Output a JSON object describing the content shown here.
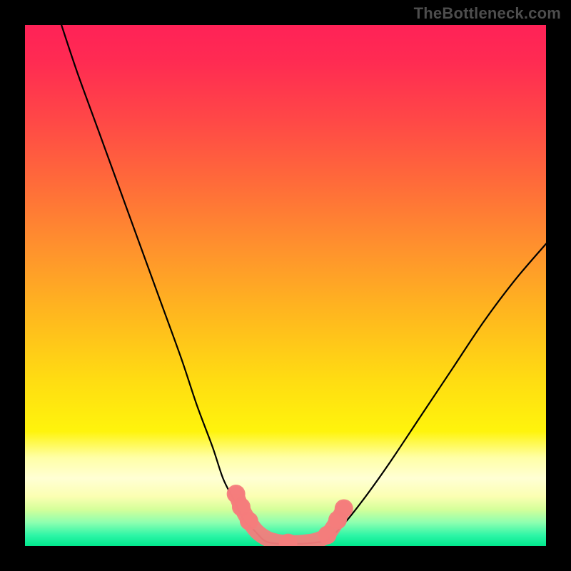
{
  "watermark": "TheBottleneck.com",
  "chart_data": {
    "type": "line",
    "title": "",
    "xlabel": "",
    "ylabel": "",
    "xlim": [
      0,
      100
    ],
    "ylim": [
      0,
      100
    ],
    "background_gradient": {
      "stops": [
        {
          "offset": 0.0,
          "color": "#ff2257"
        },
        {
          "offset": 0.07,
          "color": "#ff2b52"
        },
        {
          "offset": 0.18,
          "color": "#ff4747"
        },
        {
          "offset": 0.3,
          "color": "#ff6a3a"
        },
        {
          "offset": 0.42,
          "color": "#ff8f2e"
        },
        {
          "offset": 0.55,
          "color": "#ffb61f"
        },
        {
          "offset": 0.68,
          "color": "#ffdc12"
        },
        {
          "offset": 0.78,
          "color": "#fff40c"
        },
        {
          "offset": 0.83,
          "color": "#ffffa6"
        },
        {
          "offset": 0.87,
          "color": "#ffffd4"
        },
        {
          "offset": 0.905,
          "color": "#fbffb2"
        },
        {
          "offset": 0.93,
          "color": "#d4ff9a"
        },
        {
          "offset": 0.955,
          "color": "#8dffb0"
        },
        {
          "offset": 0.98,
          "color": "#2cf5a6"
        },
        {
          "offset": 1.0,
          "color": "#00e88d"
        }
      ]
    },
    "series": [
      {
        "name": "left-curve",
        "x": [
          7,
          10,
          14,
          18,
          22,
          26,
          30,
          33,
          36,
          38,
          40,
          42,
          44,
          46
        ],
        "y": [
          100,
          91,
          80,
          69,
          58,
          47,
          36,
          27,
          19,
          13,
          9,
          5,
          3,
          1
        ],
        "stroke": "#000000",
        "width": 2.1
      },
      {
        "name": "floor",
        "x": [
          46,
          48,
          50,
          52,
          54,
          56,
          58
        ],
        "y": [
          1,
          0.5,
          0.4,
          0.4,
          0.5,
          0.7,
          1.2
        ],
        "stroke": "#000000",
        "width": 2.1
      },
      {
        "name": "right-curve",
        "x": [
          58,
          61,
          65,
          70,
          76,
          82,
          88,
          94,
          100
        ],
        "y": [
          1.2,
          4,
          9,
          16,
          25,
          34,
          43,
          51,
          58
        ],
        "stroke": "#000000",
        "width": 2.1
      },
      {
        "name": "marker-band",
        "type": "scatter",
        "points": [
          {
            "x": 40.5,
            "y": 10.0
          },
          {
            "x": 41.5,
            "y": 7.5
          },
          {
            "x": 43.0,
            "y": 4.8
          },
          {
            "x": 44.5,
            "y": 2.8
          },
          {
            "x": 46.5,
            "y": 1.4
          },
          {
            "x": 48.5,
            "y": 0.8
          },
          {
            "x": 50.5,
            "y": 0.6
          },
          {
            "x": 52.5,
            "y": 0.6
          },
          {
            "x": 54.5,
            "y": 0.8
          },
          {
            "x": 56.0,
            "y": 1.1
          },
          {
            "x": 58.0,
            "y": 2.1
          },
          {
            "x": 60.0,
            "y": 5.0
          },
          {
            "x": 61.2,
            "y": 7.2
          }
        ],
        "color": "#f47c7c",
        "radius": 11
      }
    ]
  }
}
